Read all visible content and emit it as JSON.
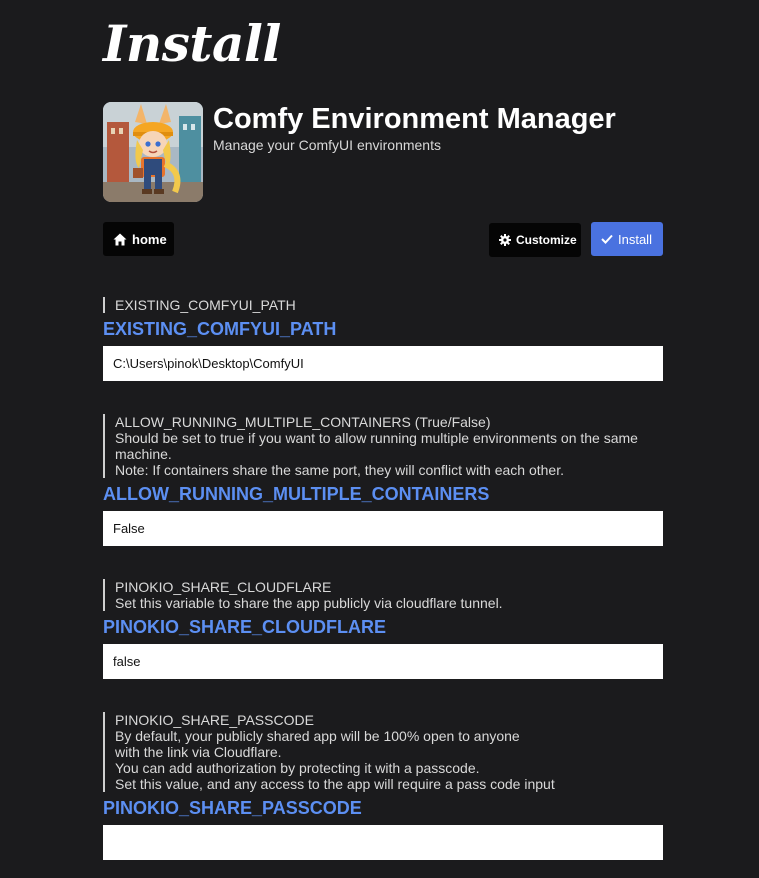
{
  "page": {
    "title": "Install"
  },
  "app": {
    "name": "Comfy Environment Manager",
    "description": "Manage your ComfyUI environments"
  },
  "toolbar": {
    "home_label": "home",
    "customize_label": "Customize",
    "install_label": "Install"
  },
  "fields": [
    {
      "description": "EXISTING_COMFYUI_PATH",
      "label": "EXISTING_COMFYUI_PATH",
      "value": "C:\\Users\\pinok\\Desktop\\ComfyUI"
    },
    {
      "description": "ALLOW_RUNNING_MULTIPLE_CONTAINERS (True/False)\nShould be set to true if you want to allow running multiple environments on the same machine.\nNote: If containers share the same port, they will conflict with each other.",
      "label": "ALLOW_RUNNING_MULTIPLE_CONTAINERS",
      "value": "False"
    },
    {
      "description": "PINOKIO_SHARE_CLOUDFLARE\nSet this variable to share the app publicly via cloudflare tunnel.",
      "label": "PINOKIO_SHARE_CLOUDFLARE",
      "value": "false"
    },
    {
      "description": "PINOKIO_SHARE_PASSCODE\nBy default, your publicly shared app will be 100% open to anyone\nwith the link via Cloudflare.\nYou can add authorization by protecting it with a passcode.\nSet this value, and any access to the app will require a pass code input",
      "label": "PINOKIO_SHARE_PASSCODE",
      "value": ""
    }
  ],
  "icons": {
    "home": "home-icon",
    "customize": "gear-icon",
    "install": "check-icon"
  },
  "colors": {
    "background": "#1b1b1d",
    "accent": "#5c8ff2",
    "install_button": "#4a72e0"
  }
}
